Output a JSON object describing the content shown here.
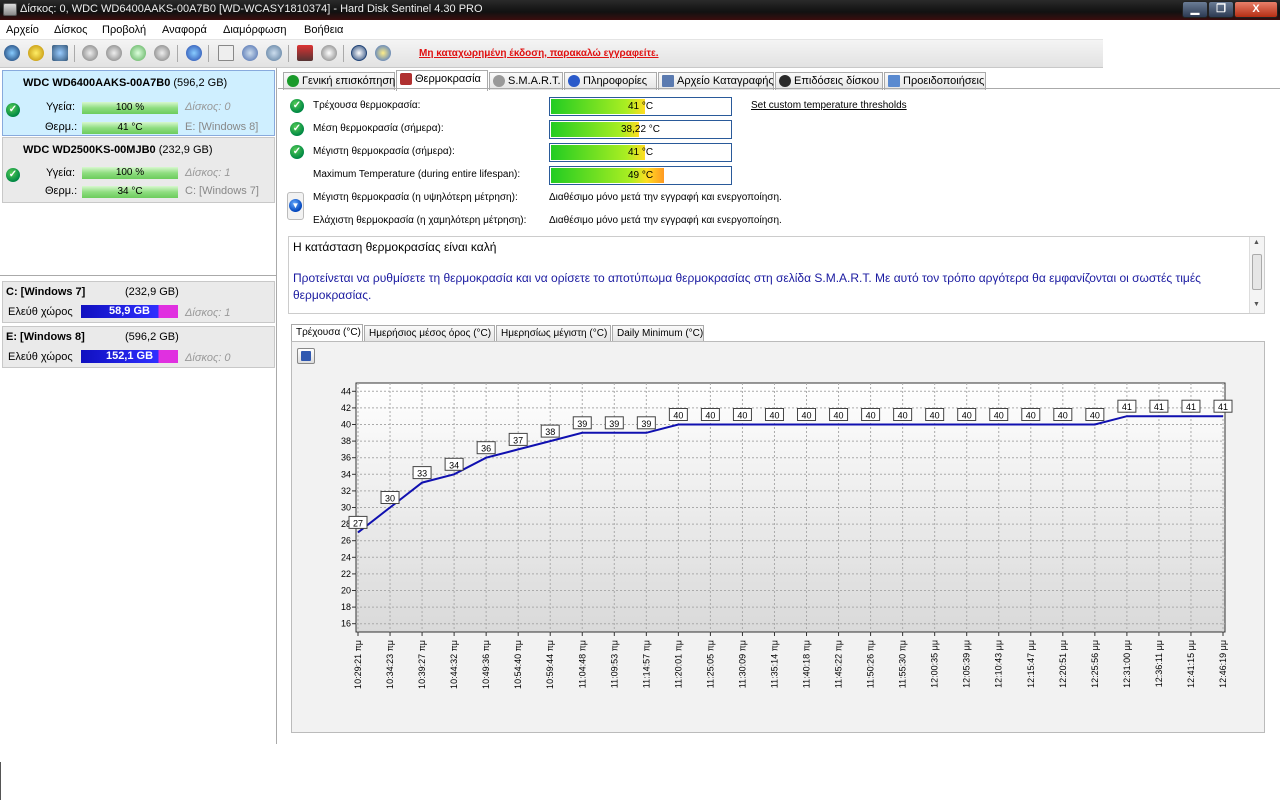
{
  "window": {
    "title": "Δίσκος: 0, WDC WD6400AAKS-00A7B0 [WD-WCASY1810374]  -  Hard Disk Sentinel 4.30 PRO",
    "min_label": "▁",
    "max_label": "❐",
    "close_label": "X"
  },
  "menu": [
    "Αρχείο",
    "Δίσκος",
    "Προβολή",
    "Αναφορά",
    "Διαμόρφωση",
    "Βοήθεια"
  ],
  "toolbar": {
    "registration_notice": "Μη καταχωρημένη έκδοση, παρακαλώ εγγραφείτε."
  },
  "disks": [
    {
      "name": "WDC WD6400AAKS-00A7B0",
      "size": "(596,2 GB)",
      "health_label": "Υγεία:",
      "health_value": "100 %",
      "health_fraction": 1.0,
      "temp_label": "Θερμ.:",
      "temp_value": "41 °C",
      "disk_ref": "Δίσκος: 0",
      "volume_ref": "E: [Windows 8]",
      "selected": true
    },
    {
      "name": "WDC WD2500KS-00MJB0",
      "size": "(232,9 GB)",
      "health_label": "Υγεία:",
      "health_value": "100 %",
      "health_fraction": 1.0,
      "temp_label": "Θερμ.:",
      "temp_value": "34 °C",
      "disk_ref": "Δίσκος: 1",
      "volume_ref": "C: [Windows 7]",
      "selected": false
    }
  ],
  "volumes": [
    {
      "name": "C: [Windows 7]",
      "size": "(232,9 GB)",
      "free_label": "Ελεύθ χώρος",
      "free_value": "58,9 GB",
      "disk_ref": "Δίσκος: 1"
    },
    {
      "name": "E: [Windows 8]",
      "size": "(596,2 GB)",
      "free_label": "Ελεύθ χώρος",
      "free_value": "152,1 GB",
      "disk_ref": "Δίσκος: 0"
    }
  ],
  "tabs": [
    {
      "label": "Γενική επισκόπηση",
      "icon": "check-icon",
      "color": "#1a9a2a"
    },
    {
      "label": "Θερμοκρασία",
      "icon": "thermometer-icon",
      "color": "#b03030",
      "active": true
    },
    {
      "label": "S.M.A.R.T.",
      "icon": "disk-icon",
      "color": "#888888"
    },
    {
      "label": "Πληροφορίες",
      "icon": "info-icon",
      "color": "#2a5aca"
    },
    {
      "label": "Αρχείο Καταγραφής",
      "icon": "log-icon",
      "color": "#5a7ab0"
    },
    {
      "label": "Επιδόσεις δίσκου",
      "icon": "gauge-icon",
      "color": "#2a2a2a"
    },
    {
      "label": "Προειδοποιήσεις",
      "icon": "alert-icon",
      "color": "#5a8ad0"
    }
  ],
  "temperature": {
    "rows": [
      {
        "label": "Τρέχουσα θερμοκρασία:",
        "value": "41 °C",
        "level": 0.41,
        "has_check": true
      },
      {
        "label": "Μέση θερμοκρασία (σήμερα):",
        "value": "38,22 °C",
        "level": 0.38,
        "has_check": true
      },
      {
        "label": "Μέγιστη θερμοκρασία (σήμερα):",
        "value": "41 °C",
        "level": 0.41,
        "has_check": true
      },
      {
        "label": "Maximum Temperature (during entire lifespan):",
        "value": "49 °C",
        "level": 0.49,
        "has_check": false
      }
    ],
    "custom_link": "Set custom temperature thresholds",
    "extra_rows": [
      {
        "label": "Μέγιστη θερμοκρασία (η υψηλότερη μέτρηση):",
        "value": "Διαθέσιμο μόνο μετά την εγγραφή και ενεργοποίηση."
      },
      {
        "label": "Ελάχιστη θερμοκρασία (η χαμηλότερη μέτρηση):",
        "value": "Διαθέσιμο μόνο μετά την εγγραφή και ενεργοποίηση."
      }
    ],
    "status_title": "Η κατάσταση θερμοκρασίας είναι καλή",
    "status_text": "Προτείνεται να ρυθμίσετε τη θερμοκρασία και να ορίσετε το αποτύπωμα θερμοκρασίας στη σελίδα S.M.A.R.T. Με αυτό τον τρόπο αργότερα θα εμφανίζονται οι σωστές τιμές θερμοκρασίας."
  },
  "chart_tabs": [
    "Τρέχουσα (°C)",
    "Ημερήσιος μέσος όρος (°C)",
    "Ημερησίως μέγιστη (°C)",
    "Daily Minimum (°C)"
  ],
  "chart_data": {
    "type": "line",
    "x": [
      "10:29:21 πμ",
      "10:34:23 πμ",
      "10:39:27 πμ",
      "10:44:32 πμ",
      "10:49:36 πμ",
      "10:54:40 πμ",
      "10:59:44 πμ",
      "11:04:48 πμ",
      "11:09:53 πμ",
      "11:14:57 πμ",
      "11:20:01 πμ",
      "11:25:05 πμ",
      "11:30:09 πμ",
      "11:35:14 πμ",
      "11:40:18 πμ",
      "11:45:22 πμ",
      "11:50:26 πμ",
      "11:55:30 πμ",
      "12:00:35 μμ",
      "12:05:39 μμ",
      "12:10:43 μμ",
      "12:15:47 μμ",
      "12:20:51 μμ",
      "12:25:56 μμ",
      "12:31:00 μμ",
      "12:36:11 μμ",
      "12:41:15 μμ",
      "12:46:19 μμ"
    ],
    "series": [
      {
        "values": [
          27,
          30,
          33,
          34,
          36,
          37,
          38,
          39,
          39,
          39,
          40,
          40,
          40,
          40,
          40,
          40,
          40,
          40,
          40,
          40,
          40,
          40,
          40,
          40,
          41,
          41,
          41,
          41
        ]
      }
    ],
    "yticks": [
      16,
      18,
      20,
      22,
      24,
      26,
      28,
      30,
      32,
      34,
      36,
      38,
      40,
      42,
      44
    ],
    "ylim": [
      15,
      45
    ],
    "grid": true,
    "line_color": "#1010b0"
  }
}
